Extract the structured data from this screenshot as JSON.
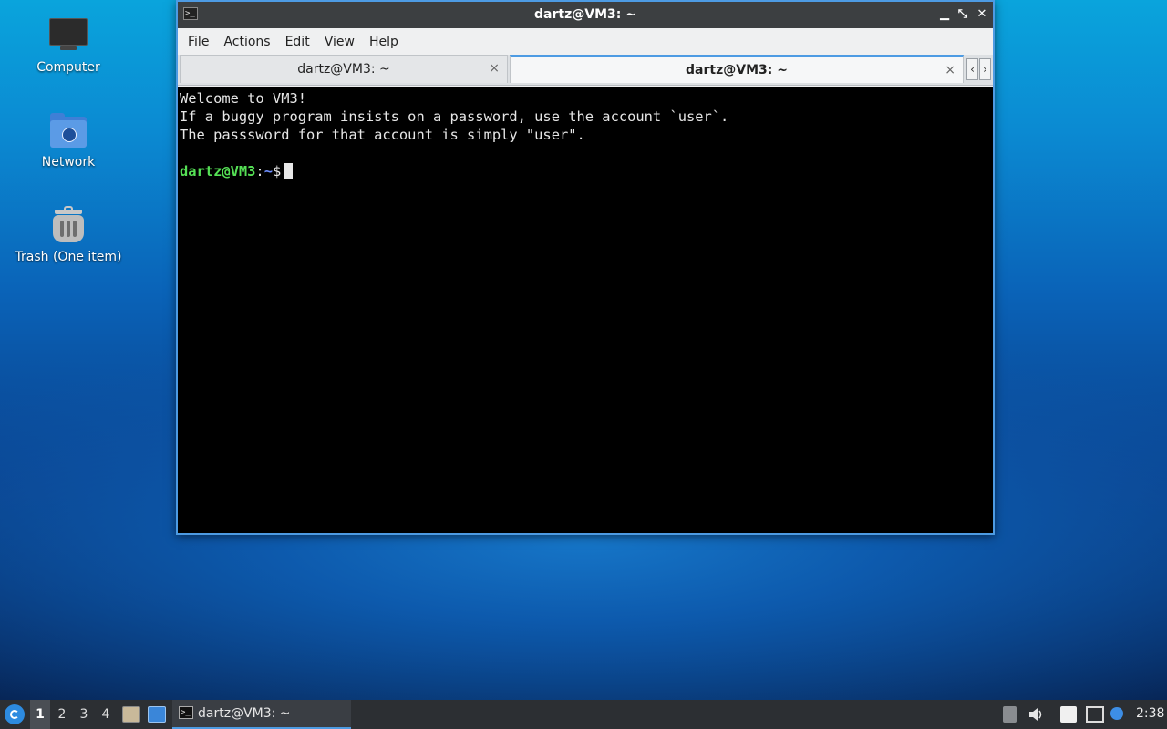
{
  "desktop": {
    "icons": [
      {
        "label": "Computer",
        "icon": "computer-icon"
      },
      {
        "label": "Network",
        "icon": "network-folder-icon"
      },
      {
        "label": "Trash (One item)",
        "icon": "trash-icon"
      }
    ]
  },
  "window": {
    "title": "dartz@VM3: ~",
    "app_icon_glyph": ">_",
    "controls": {
      "minimize": "▁",
      "restore": "⤡",
      "close": "✕"
    },
    "menu": [
      "File",
      "Actions",
      "Edit",
      "View",
      "Help"
    ],
    "tabs": [
      {
        "label": "dartz@VM3: ~",
        "active": false,
        "close": "×"
      },
      {
        "label": "dartz@VM3: ~",
        "active": true,
        "close": "×"
      }
    ],
    "tab_scroll": {
      "left": "‹",
      "right": "›"
    },
    "terminal": {
      "lines": [
        "Welcome to VM3!",
        "If a buggy program insists on a password, use the account `user`.",
        "The passsword for that account is simply \"user\".",
        ""
      ],
      "prompt_user": "dartz@VM3",
      "prompt_sep": ":",
      "prompt_path": "~",
      "prompt_symbol": "$"
    }
  },
  "taskbar": {
    "workspaces": [
      "1",
      "2",
      "3",
      "4"
    ],
    "current_workspace": "1",
    "task_label": "dartz@VM3: ~",
    "clock": "2:38"
  },
  "colors": {
    "accent": "#4d9be3",
    "terminal_bg": "#000000",
    "prompt_user": "#55e055",
    "prompt_path": "#6f8fff"
  }
}
